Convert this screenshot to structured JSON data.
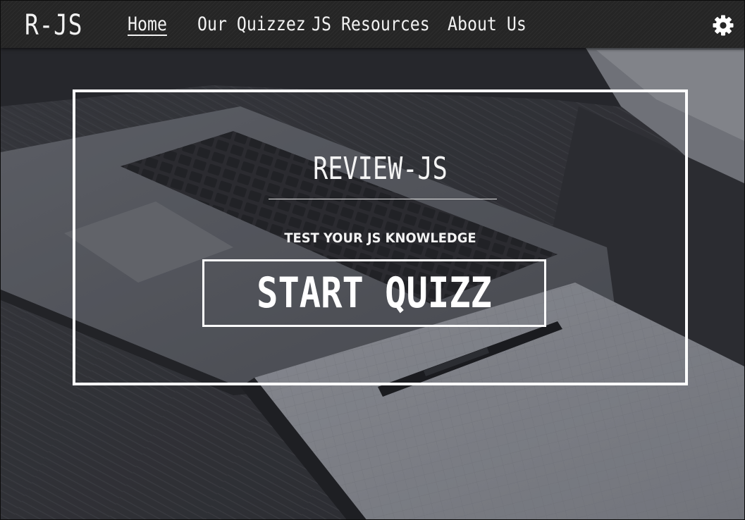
{
  "navbar": {
    "logo": "R-JS",
    "links": [
      {
        "label": "Home",
        "active": true
      },
      {
        "label": "Our Quizzez",
        "active": false
      },
      {
        "label": "JS Resources",
        "active": false
      },
      {
        "label": "About Us",
        "active": false
      }
    ],
    "settings_icon": "gear-icon"
  },
  "hero": {
    "title": "REVIEW-JS",
    "subtitle": "TEST YOUR JS KNOWLEDGE",
    "button_label": "START QUIZZ",
    "background": "laptop-notebook-pen-photo"
  },
  "colors": {
    "navbar": "#252525",
    "text": "#ffffff",
    "frame": "#ffffff",
    "overlay": "#2a2c32"
  }
}
